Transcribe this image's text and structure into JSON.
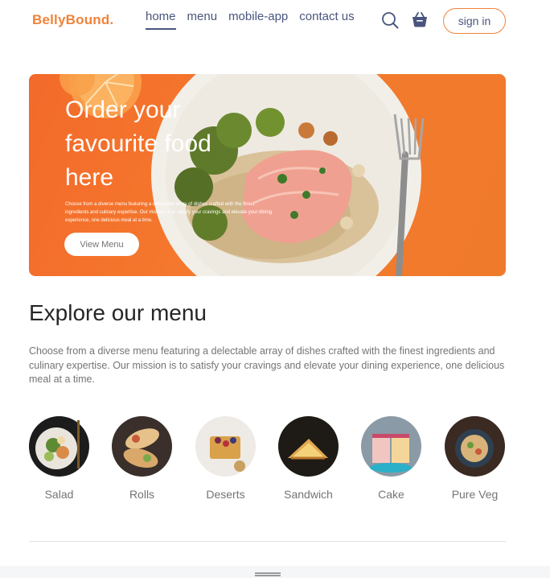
{
  "brand": {
    "logo": "BellyBound."
  },
  "nav": {
    "items": [
      {
        "label": "home",
        "active": true
      },
      {
        "label": "menu",
        "active": false
      },
      {
        "label": "mobile-app",
        "active": false
      },
      {
        "label": "contact us",
        "active": false
      }
    ],
    "search_icon": "search-icon",
    "basket_icon": "basket-icon",
    "sign_in": "sign in"
  },
  "hero": {
    "title": "Order your favourite food here",
    "description": "Choose from a diverse menu featuring a delectable array of dishes crafted with the finest ingredients and culinary expertise. Our mission is to satisfy your cravings and elevate your dining experience, one delicious meal at a time.",
    "button": "View Menu"
  },
  "explore": {
    "title": "Explore our menu",
    "description": "Choose from a diverse menu featuring a delectable array of dishes crafted with the finest ingredients and culinary expertise. Our mission is to satisfy your cravings and elevate your dining experience, one delicious meal at a time.",
    "items": [
      {
        "label": "Salad"
      },
      {
        "label": "Rolls"
      },
      {
        "label": "Deserts"
      },
      {
        "label": "Sandwich"
      },
      {
        "label": "Cake"
      },
      {
        "label": "Pure Veg"
      }
    ]
  },
  "colors": {
    "accent": "#f0833a",
    "hero_bg": "#f47a2e",
    "text": "#49557e",
    "muted": "#747474"
  }
}
